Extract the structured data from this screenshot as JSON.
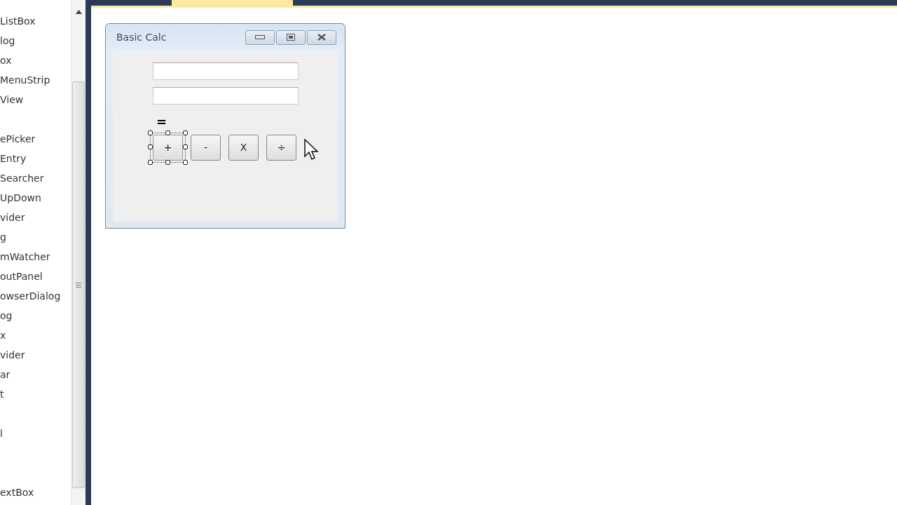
{
  "toolbox": {
    "items": [
      {
        "kind": "item",
        "label": "ListBox"
      },
      {
        "kind": "item",
        "label": "log"
      },
      {
        "kind": "item",
        "label": "ox"
      },
      {
        "kind": "item",
        "label": "MenuStrip"
      },
      {
        "kind": "item",
        "label": "View"
      },
      {
        "kind": "blank"
      },
      {
        "kind": "item",
        "label": "ePicker"
      },
      {
        "kind": "item",
        "label": "Entry"
      },
      {
        "kind": "item",
        "label": "Searcher"
      },
      {
        "kind": "item",
        "label": "UpDown"
      },
      {
        "kind": "item",
        "label": "vider"
      },
      {
        "kind": "item",
        "label": "g"
      },
      {
        "kind": "item",
        "label": "mWatcher"
      },
      {
        "kind": "item",
        "label": "outPanel"
      },
      {
        "kind": "item",
        "label": "owserDialog"
      },
      {
        "kind": "item",
        "label": "og"
      },
      {
        "kind": "item",
        "label": "x"
      },
      {
        "kind": "item",
        "label": "vider"
      },
      {
        "kind": "item",
        "label": "ar"
      },
      {
        "kind": "item",
        "label": "t"
      },
      {
        "kind": "blank"
      },
      {
        "kind": "item",
        "label": "l"
      },
      {
        "kind": "blank"
      },
      {
        "kind": "blank"
      },
      {
        "kind": "item",
        "label": "extBox"
      }
    ]
  },
  "form": {
    "title": "Basic Calc",
    "fields": [
      {
        "kind": "textbox"
      },
      {
        "kind": "textbox"
      }
    ],
    "result_label": "=",
    "buttons": [
      {
        "label": "+",
        "selected": true
      },
      {
        "label": "-",
        "selected": false
      },
      {
        "label": "X",
        "selected": false
      },
      {
        "label": "÷",
        "selected": false
      }
    ]
  }
}
